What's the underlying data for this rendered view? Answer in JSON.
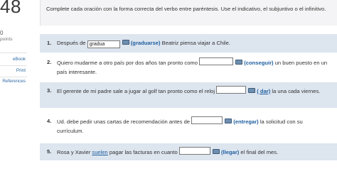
{
  "question_number": "48",
  "instructions": "Complete cada oración con la forma correcta del verbo entre paréntesis. Use el indicativo, el subjuntivo o el infinitivo.",
  "sidebar": {
    "points_value": "0",
    "points_label": "points",
    "links": [
      "eBook",
      "Print",
      "References"
    ]
  },
  "questions": [
    {
      "number": "1.",
      "before": "Después de",
      "answer": "gradua",
      "verb": "(graduarse)",
      "after": " Beatriz piensa viajar a Chile."
    },
    {
      "number": "2.",
      "before": "Quiero mudarme a otro país por dos años tan pronto como",
      "answer": "",
      "verb": "(conseguir)",
      "after": " un buen puesto en un país interesante."
    },
    {
      "number": "3.",
      "before": "El gerente de mi padre sale a jugar al golf tan pronto como el reloj",
      "answer": "",
      "verb": "( dar)",
      "after": " la una cada viernes."
    },
    {
      "number": "4.",
      "before": "Ud. debe pedir unas cartas de recomendación antes de",
      "answer": "",
      "verb": "(entregar)",
      "after": " la solicitud con su currículum."
    },
    {
      "number": "5.",
      "before": "Rosa y Xavier",
      "linked_word": "suelen",
      "middle": " pagar las facturas en cuanto",
      "answer": "",
      "verb": "(llegar)",
      "after": " el final del mes."
    }
  ]
}
